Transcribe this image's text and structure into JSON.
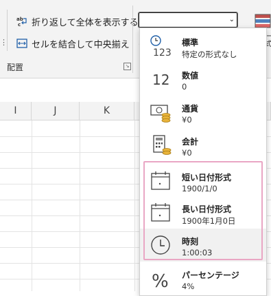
{
  "ribbon": {
    "wrap_text_label": "折り返して全体を表示する",
    "merge_center_label": "セルを結合して中央揃え",
    "wrap_icon_text": "ab\nc",
    "group_label": "配置",
    "side_label": "ー付\n式"
  },
  "number_format_box": {
    "value": ""
  },
  "columns": [
    "I",
    "J",
    "K"
  ],
  "dropdown": {
    "items": [
      {
        "title": "標準",
        "sample": "特定の形式なし",
        "icon": "clock-123-icon",
        "icon_text": "123"
      },
      {
        "title": "数値",
        "sample": "0",
        "icon": "number-12-icon",
        "icon_text": "12"
      },
      {
        "title": "通貨",
        "sample": "¥0",
        "icon": "currency-icon"
      },
      {
        "title": "会計",
        "sample": " ¥0",
        "icon": "accounting-icon"
      },
      {
        "title": "短い日付形式",
        "sample": "1900/1/0",
        "icon": "calendar-icon"
      },
      {
        "title": "長い日付形式",
        "sample": "1900年1月0日",
        "icon": "calendar-icon"
      },
      {
        "title": "時刻",
        "sample": "1:00:03",
        "icon": "clock-icon"
      },
      {
        "title": "パーセンテージ",
        "sample": "4%",
        "icon": "percent-icon",
        "icon_text": "%"
      }
    ]
  },
  "colors": {
    "highlight_border": "#e9a6c4",
    "accent_blue": "#1f5fa8",
    "hover_bg": "#f1f1f1"
  }
}
